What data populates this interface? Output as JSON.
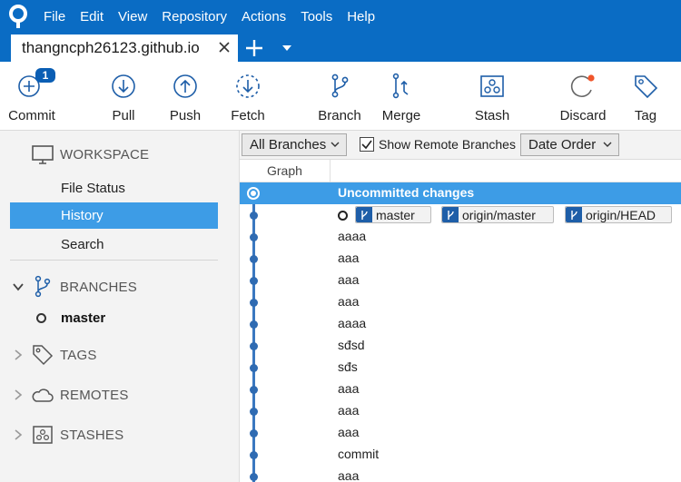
{
  "menu": [
    "File",
    "Edit",
    "View",
    "Repository",
    "Actions",
    "Tools",
    "Help"
  ],
  "tab": {
    "title": "thangncph26123.github.io"
  },
  "toolbar": {
    "commit": {
      "label": "Commit",
      "badge": "1"
    },
    "pull": "Pull",
    "push": "Push",
    "fetch": "Fetch",
    "branch": "Branch",
    "merge": "Merge",
    "stash": "Stash",
    "discard": "Discard",
    "tag": "Tag"
  },
  "sidebar": {
    "workspace": {
      "title": "WORKSPACE",
      "items": [
        "File Status",
        "History",
        "Search"
      ],
      "active": "History"
    },
    "branches": {
      "title": "BRANCHES",
      "items": [
        "master"
      ]
    },
    "tags": "TAGS",
    "remotes": "REMOTES",
    "stashes": "STASHES"
  },
  "filter": {
    "branches_select": "All Branches",
    "show_remote_label": "Show Remote Branches",
    "show_remote_checked": true,
    "order_select": "Date Order"
  },
  "columns": {
    "graph": "Graph"
  },
  "history": {
    "uncommitted": "Uncommitted changes",
    "refs": [
      "master",
      "origin/master",
      "origin/HEAD"
    ],
    "commits": [
      "aaaa",
      "aaa",
      "aaa",
      "aaa",
      "aaaa",
      "sđsd",
      "sđs",
      "aaa",
      "aaa",
      "aaa",
      "commit",
      "aaa"
    ]
  },
  "colors": {
    "accent": "#0a6cc4",
    "selection": "#3d9ce6",
    "graph": "#2f6bb2"
  }
}
